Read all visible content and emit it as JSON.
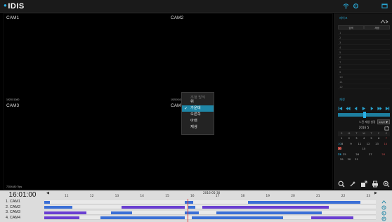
{
  "app": {
    "logo_text": "IDIS"
  },
  "cameras": [
    {
      "label": "CAM1",
      "resolution": ""
    },
    {
      "label": "CAM2",
      "resolution": ""
    },
    {
      "label": "CAM3",
      "resolution": "1920X1080"
    },
    {
      "label": "CAM4",
      "resolution": "1920X1080"
    }
  ],
  "bottom_resolution": "720X480 7fps",
  "context_menu": {
    "title": "조정 방식",
    "items": [
      {
        "label": "위",
        "checked": false
      },
      {
        "label": "가운데",
        "checked": true
      },
      {
        "label": "오른쪽",
        "checked": false
      },
      {
        "label": "아래",
        "checked": false
      },
      {
        "label": "재생",
        "checked": false
      }
    ]
  },
  "right_panel": {
    "title": "레이크",
    "tabs": [
      "검색",
      "재생"
    ],
    "channels": [
      "1",
      "2",
      "3",
      "4",
      "5",
      "6",
      "7",
      "8",
      "9",
      "10",
      "11",
      "12"
    ],
    "playback_title": "재생",
    "speed_label": "느린 재생 설정",
    "speed_value": "x1/2 ▼",
    "calendar": {
      "header": "2016 5",
      "dow": [
        "S",
        "M",
        "T",
        "W",
        "T",
        "F",
        "S"
      ],
      "weeks": [
        [
          "1",
          "2",
          "3",
          "4",
          "5",
          "6",
          "7"
        ],
        [
          "8",
          "9",
          "10",
          "11",
          "12",
          "13",
          "14"
        ],
        [
          "15",
          "16",
          "17",
          "18",
          "19",
          "20",
          "21"
        ],
        [
          "22",
          "23",
          "24",
          "25",
          "26",
          "27",
          "28"
        ],
        [
          "29",
          "30",
          "31",
          "",
          "",
          "",
          ""
        ]
      ],
      "recorded_days": [
        "10",
        "16",
        "17",
        "18",
        "19",
        "20",
        "21",
        "22",
        "23",
        "24"
      ],
      "today": "20"
    }
  },
  "timeline": {
    "current_time": "16:01:00",
    "date": "2016-05-30",
    "hours": [
      "11",
      "12",
      "13",
      "14",
      "15",
      "16",
      "17",
      "18",
      "19",
      "20",
      "21",
      "22",
      "23"
    ],
    "cameras": [
      "1. CAM1",
      "2. CAM2",
      "3. CAM3",
      "4. CAM4"
    ],
    "record_color": "#3b6fd6",
    "event_color": "#6a3fd1"
  }
}
